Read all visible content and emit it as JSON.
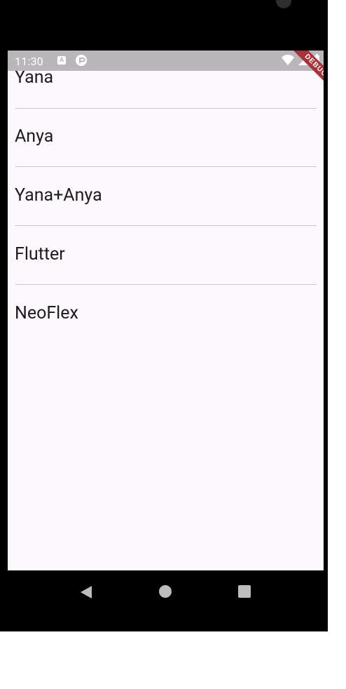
{
  "status_bar": {
    "time": "11:30",
    "notification_a": "A",
    "icons": [
      "wifi-icon",
      "signal-icon",
      "battery-icon"
    ]
  },
  "debug_banner": {
    "label": "DEBUG",
    "color": "#a8323a"
  },
  "list": {
    "items": [
      {
        "label": "Yana"
      },
      {
        "label": "Anya"
      },
      {
        "label": "Yana+Anya"
      },
      {
        "label": "Flutter"
      },
      {
        "label": "NeoFlex"
      }
    ]
  },
  "navigation": {
    "buttons": [
      "back-icon",
      "home-icon",
      "recents-icon"
    ]
  },
  "colors": {
    "screen_background": "#fdf7fe",
    "status_bar_background": "#bbb6bc",
    "text": "#1d1b20",
    "divider": "#c9c5ca"
  }
}
